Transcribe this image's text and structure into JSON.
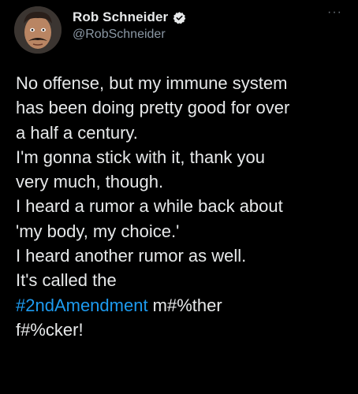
{
  "author": {
    "display_name": "Rob Schneider",
    "handle": "@RobSchneider",
    "verified": true
  },
  "menu": {
    "more_glyph": "···"
  },
  "tweet": {
    "lines": [
      "No offense, but my immune system",
      "has been doing pretty good for over",
      "a half a century.",
      "I'm gonna stick with it, thank you",
      "very much, though.",
      "I heard a rumor a while back about",
      "'my body, my choice.'",
      "I heard another rumor as well.",
      "It's called the"
    ],
    "hashtag": "#2ndAmendment",
    "after_hashtag": " m#%ther",
    "last_line": "f#%cker!"
  },
  "colors": {
    "background": "#000000",
    "text": "#e7e9ea",
    "secondary": "#8b98a5",
    "link": "#1d9bf0",
    "verified_badge": "#e7e9ea"
  }
}
